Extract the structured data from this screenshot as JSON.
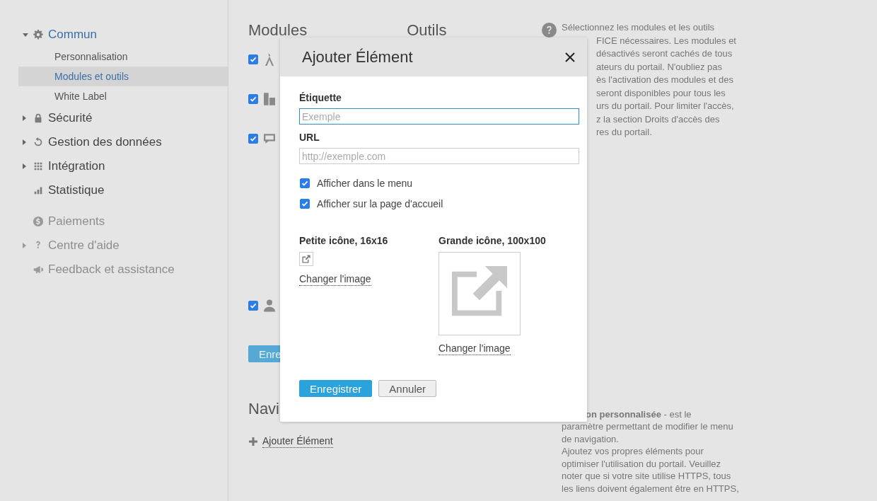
{
  "sidebar": {
    "items": [
      {
        "label": "Commun",
        "expandable": true,
        "expanded": true,
        "disabled": false,
        "children": [
          {
            "label": "Personnalisation",
            "selected": false
          },
          {
            "label": "Modules et outils",
            "selected": true
          },
          {
            "label": "White Label",
            "selected": false
          }
        ]
      },
      {
        "label": "Sécurité",
        "expandable": true,
        "expanded": false,
        "disabled": false
      },
      {
        "label": "Gestion des données",
        "expandable": true,
        "expanded": false,
        "disabled": false
      },
      {
        "label": "Intégration",
        "expandable": true,
        "expanded": false,
        "disabled": false
      },
      {
        "label": "Statistique",
        "expandable": false,
        "expanded": false,
        "disabled": false
      },
      {
        "label": "Paiements",
        "expandable": false,
        "expanded": false,
        "disabled": true
      },
      {
        "label": "Centre d'aide",
        "expandable": true,
        "expanded": false,
        "disabled": true
      },
      {
        "label": "Feedback et assistance",
        "expandable": false,
        "expanded": false,
        "disabled": true
      }
    ]
  },
  "modules": {
    "headings": [
      "Modules",
      "Outils"
    ],
    "rows": [
      {
        "checked": true
      },
      {
        "checked": true
      },
      {
        "checked": true
      },
      {
        "checked": true
      }
    ],
    "save_button": "Enre"
  },
  "help_top": {
    "first_line": "Sélectionnez les modules et les outils",
    "fragments": [
      "FICE nécessaires. Les modules et",
      "désactivés seront cachés de tous",
      "ateurs du portail. N'oubliez pas",
      "ès l'activation des modules et des",
      "seront disponibles pour tous les",
      "urs du portail. Pour limiter l'accès,",
      "z la section Droits d'accès des",
      "res du portail."
    ]
  },
  "navigation": {
    "heading": "Navi",
    "add_link": "Ajouter Élément"
  },
  "help_bottom": {
    "first_line": "**on personnalisée** - est le",
    "text": "paramètre permettant de modifier le menu de navigation.",
    "text2": "Ajoutez vos propres éléments pour optimiser l'utilisation du portail. Veuillez noter que si votre site utilise HTTPS, tous les liens doivent également être en HTTPS,"
  },
  "dialog": {
    "title": "Ajouter Élément",
    "fields": [
      {
        "label": "Étiquette",
        "placeholder": "Exemple",
        "focused": true
      },
      {
        "label": "URL",
        "placeholder": "http://exemple.com",
        "focused": false
      }
    ],
    "options": [
      {
        "label": "Afficher dans le menu",
        "checked": true
      },
      {
        "label": "Afficher sur la page d'accueil",
        "checked": true
      }
    ],
    "small_icon": {
      "label": "Petite icône, 16x16",
      "link": "Changer l'image"
    },
    "large_icon": {
      "label": "Grande icône, 100x100",
      "link": "Changer l'image"
    },
    "buttons": [
      {
        "label": "Enregistrer",
        "kind": "primary"
      },
      {
        "label": "Annuler",
        "kind": "secondary"
      }
    ]
  }
}
